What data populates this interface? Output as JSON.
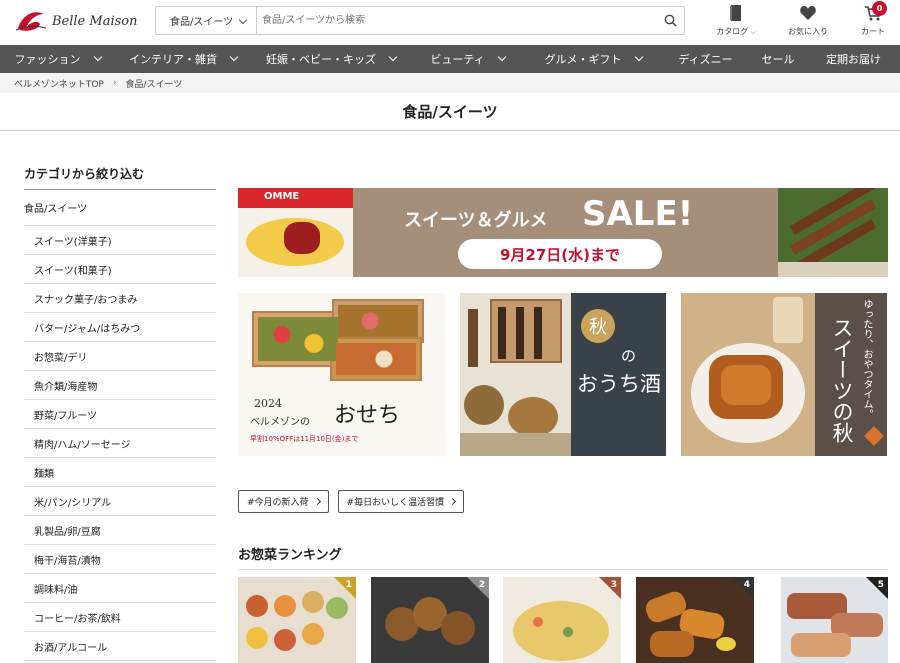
{
  "header": {
    "logo_text": "Belle Maison",
    "search": {
      "category": "食品/スイーツ",
      "placeholder": "食品/スイーツから検索"
    },
    "catalog_label": "カタログ",
    "favorites_label": "お気に入り",
    "cart_label": "カート",
    "cart_count": "0"
  },
  "nav": [
    "ファッション",
    "インテリア・雑貨",
    "妊娠・ベビー・キッズ",
    "ビューティ",
    "グルメ・ギフト",
    "ディズニー",
    "セール",
    "定期お届け"
  ],
  "breadcrumb": [
    "ベルメゾンネットTOP",
    "食品/スイーツ"
  ],
  "page_title": "食品/スイーツ",
  "sidebar": {
    "heading": "カテゴリから絞り込む",
    "top": "食品/スイーツ",
    "items": [
      "スイーツ(洋菓子)",
      "スイーツ(和菓子)",
      "スナック菓子/おつまみ",
      "バター/ジャム/はちみつ",
      "お惣菜/デリ",
      "魚介類/海産物",
      "野菜/フルーツ",
      "精肉/ハム/ソーセージ",
      "麺類",
      "米/パン/シリアル",
      "乳製品/卵/豆腐",
      "梅干/海苔/漬物",
      "調味料/油",
      "コーヒー/お茶/飲料",
      "お酒/アルコール"
    ]
  },
  "banners": {
    "sale": {
      "left_text": "OMME",
      "title": "スイーツ＆グルメ",
      "sale": "SALE!",
      "date": "9月27日(水)まで"
    },
    "osechi": {
      "year": "2024",
      "line": "ベルメゾンの",
      "title": "おせち",
      "note": "早割10%OFFは11月10日(金)まで"
    },
    "sake": {
      "circle": "秋",
      "title1": "の",
      "title2": "おうち酒"
    },
    "sweets": {
      "sub": "ゆったり、おやつタイム。",
      "title": "スイーツの秋"
    }
  },
  "tags": [
    "#今月の新入荷",
    "#毎日おいしく温活習慣"
  ],
  "ranking": {
    "title": "お惣菜ランキング",
    "items": [
      "1",
      "2",
      "3",
      "4",
      "5"
    ]
  },
  "colors": {
    "nav": "#555555",
    "cart_badge": "#c8102e",
    "sale_banner": "#a58f7b",
    "date_red": "#c8102e",
    "sake_panel": "#394149",
    "sweets_panel": "#5a4f49"
  }
}
